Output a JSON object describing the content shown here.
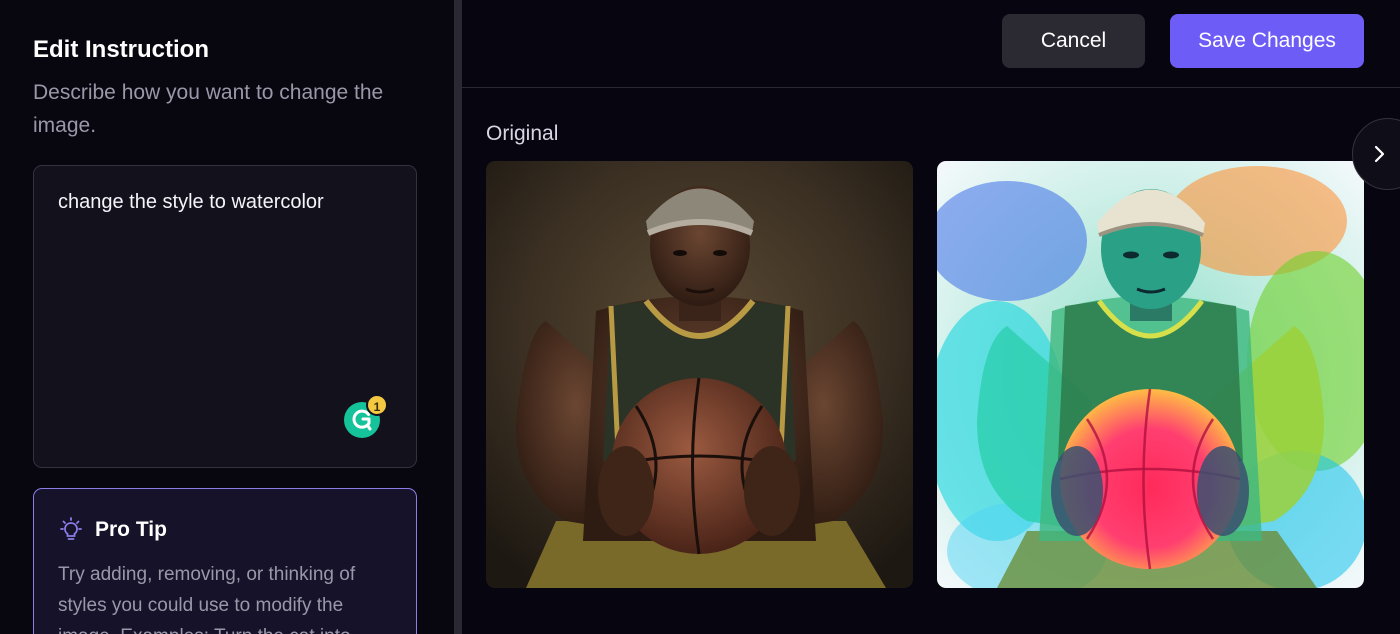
{
  "sidebar": {
    "title": "Edit Instruction",
    "subtitle": "Describe how you want to change the image.",
    "instruction": "change the style to watercolor",
    "grammarly_count": "1",
    "tip": {
      "title": "Pro Tip",
      "text": "Try adding, removing, or thinking of styles you could use to modify the image. Examples: Turn the cat into"
    }
  },
  "header": {
    "cancel_label": "Cancel",
    "save_label": "Save Changes"
  },
  "main": {
    "original_label": "Original",
    "images": [
      {
        "name": "original-image",
        "description": "basketball player holding ball, photo"
      },
      {
        "name": "edited-image",
        "description": "basketball player holding ball, watercolor"
      }
    ]
  },
  "icons": {
    "tip": "lightbulb-icon",
    "next": "chevron-right-icon",
    "grammarly": "grammarly-icon"
  },
  "colors": {
    "accent": "#6d5cf6",
    "tip_border": "#8b7ee8",
    "background": "#07050f"
  }
}
